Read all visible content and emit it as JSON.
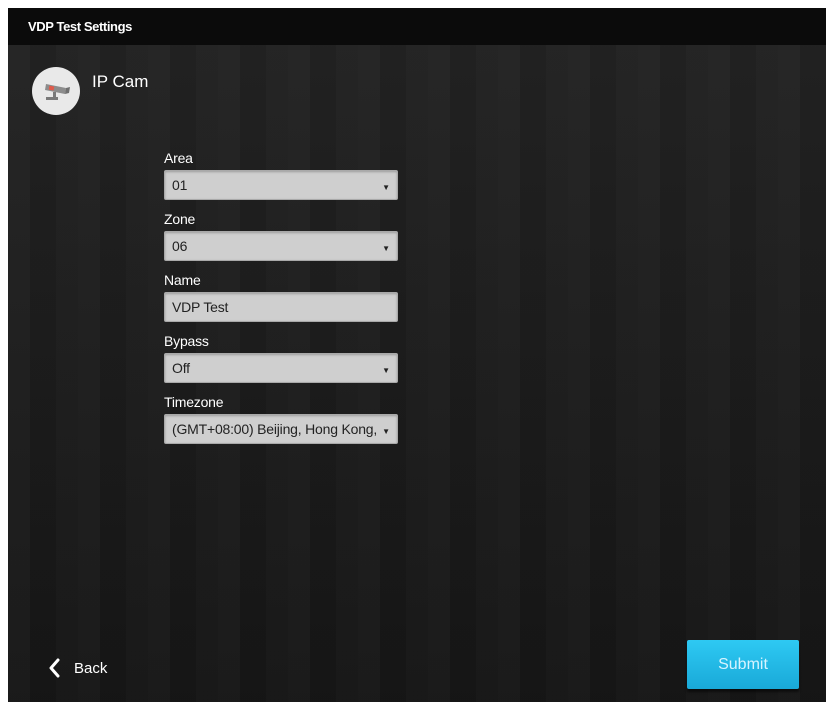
{
  "window": {
    "title": "VDP Test Settings"
  },
  "device": {
    "name": "IP Cam",
    "icon": "ip-camera-icon"
  },
  "form": {
    "area": {
      "label": "Area",
      "value": "01"
    },
    "zone": {
      "label": "Zone",
      "value": "06"
    },
    "name": {
      "label": "Name",
      "value": "VDP Test"
    },
    "bypass": {
      "label": "Bypass",
      "value": "Off"
    },
    "timezone": {
      "label": "Timezone",
      "value": "(GMT+08:00) Beijing, Hong Kong,"
    }
  },
  "footer": {
    "back_label": "Back",
    "submit_label": "Submit"
  },
  "colors": {
    "accent": "#1fb6e6",
    "field_bg": "#cfcfcf",
    "background": "#1c1c1c"
  }
}
